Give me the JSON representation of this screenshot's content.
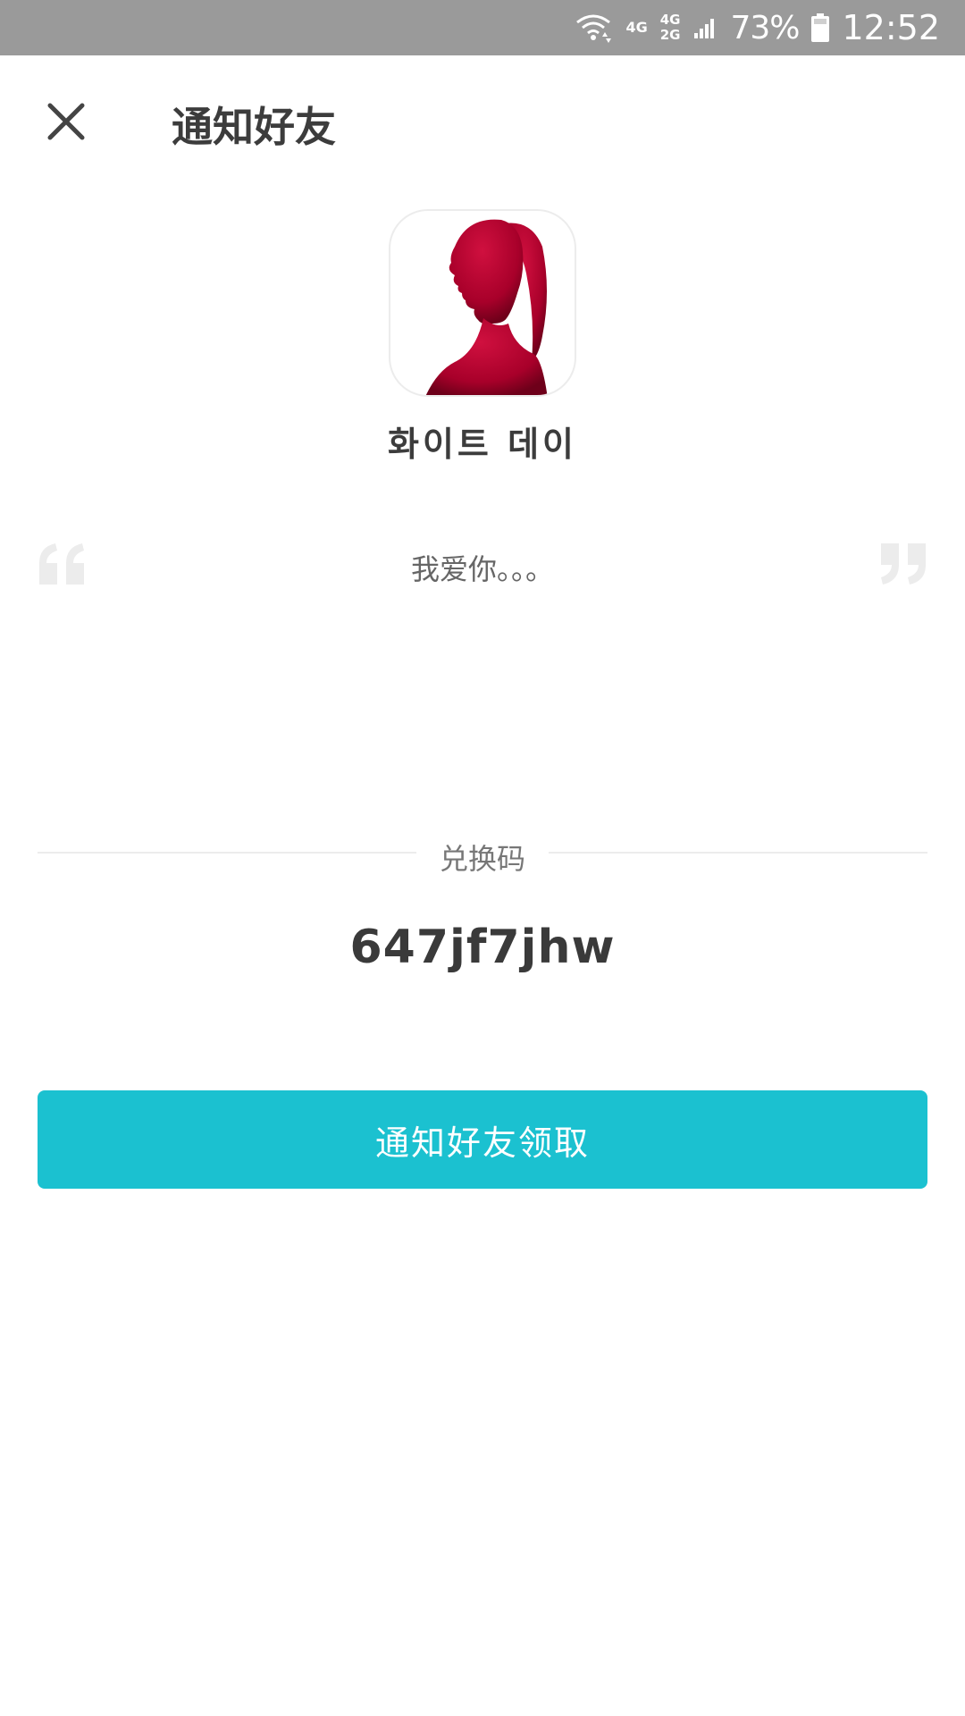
{
  "status_bar": {
    "network_1": "4G",
    "network_2_top": "4G",
    "network_2_bottom": "2G",
    "battery_percent": "73%",
    "time": "12:52"
  },
  "header": {
    "title": "通知好友",
    "close_icon": "close-icon"
  },
  "profile": {
    "name": "화이트 데이",
    "avatar_icon": "silhouette-avatar"
  },
  "message": {
    "text": "我爱你。。。",
    "open_quote_icon": "quote-open-icon",
    "close_quote_icon": "quote-close-icon"
  },
  "redeem": {
    "label": "兑换码",
    "code": "647jf7jhw"
  },
  "actions": {
    "notify_button": "通知好友领取"
  },
  "colors": {
    "status_bar": "#9a9a9a",
    "accent": "#1bc1d0",
    "avatar_red": "#b3002d"
  }
}
